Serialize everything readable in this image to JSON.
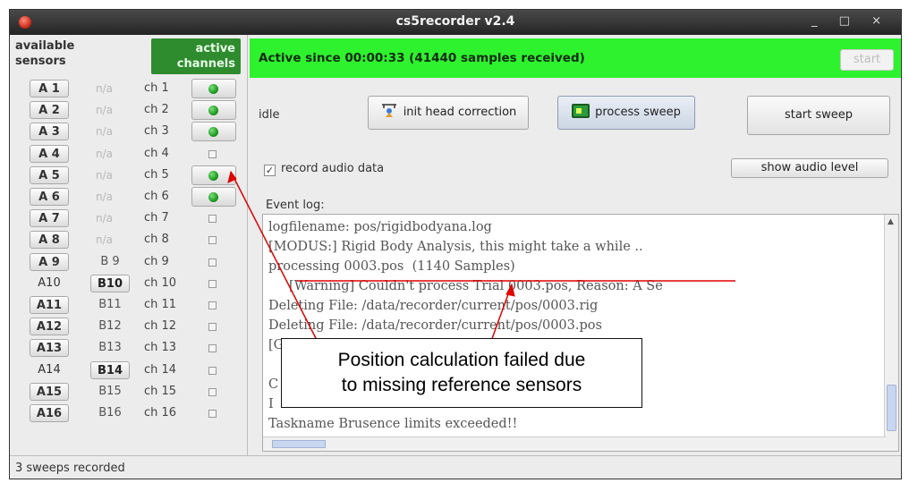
{
  "window": {
    "title": "cs5recorder v2.4",
    "controls": "_ □ ×"
  },
  "left_panel": {
    "available_header": [
      "available",
      "sensors"
    ],
    "active_header": [
      "active",
      "channels"
    ],
    "rows": [
      {
        "a": "A 1",
        "a_btn": true,
        "b": "n/a",
        "b_btn": false,
        "b_na": true,
        "ch": "ch 1",
        "active": true
      },
      {
        "a": "A 2",
        "a_btn": true,
        "b": "n/a",
        "b_btn": false,
        "b_na": true,
        "ch": "ch 2",
        "active": true
      },
      {
        "a": "A 3",
        "a_btn": true,
        "b": "n/a",
        "b_btn": false,
        "b_na": true,
        "ch": "ch 3",
        "active": true
      },
      {
        "a": "A 4",
        "a_btn": true,
        "b": "n/a",
        "b_btn": false,
        "b_na": true,
        "ch": "ch 4",
        "active": false
      },
      {
        "a": "A 5",
        "a_btn": true,
        "b": "n/a",
        "b_btn": false,
        "b_na": true,
        "ch": "ch 5",
        "active": true
      },
      {
        "a": "A 6",
        "a_btn": true,
        "b": "n/a",
        "b_btn": false,
        "b_na": true,
        "ch": "ch 6",
        "active": true
      },
      {
        "a": "A 7",
        "a_btn": true,
        "b": "n/a",
        "b_btn": false,
        "b_na": true,
        "ch": "ch 7",
        "active": false
      },
      {
        "a": "A 8",
        "a_btn": true,
        "b": "n/a",
        "b_btn": false,
        "b_na": true,
        "ch": "ch 8",
        "active": false
      },
      {
        "a": "A 9",
        "a_btn": true,
        "b": "B 9",
        "b_btn": false,
        "b_na": false,
        "ch": "ch 9",
        "active": false
      },
      {
        "a": "A10",
        "a_btn": false,
        "b": "B10",
        "b_btn": true,
        "b_na": false,
        "ch": "ch 10",
        "active": false
      },
      {
        "a": "A11",
        "a_btn": true,
        "b": "B11",
        "b_btn": false,
        "b_na": false,
        "ch": "ch 11",
        "active": false
      },
      {
        "a": "A12",
        "a_btn": true,
        "b": "B12",
        "b_btn": false,
        "b_na": false,
        "ch": "ch 12",
        "active": false
      },
      {
        "a": "A13",
        "a_btn": true,
        "b": "B13",
        "b_btn": false,
        "b_na": false,
        "ch": "ch 13",
        "active": false
      },
      {
        "a": "A14",
        "a_btn": false,
        "b": "B14",
        "b_btn": true,
        "b_na": false,
        "ch": "ch 14",
        "active": false
      },
      {
        "a": "A15",
        "a_btn": true,
        "b": "B15",
        "b_btn": false,
        "b_na": false,
        "ch": "ch 15",
        "active": false
      },
      {
        "a": "A16",
        "a_btn": true,
        "b": "B16",
        "b_btn": false,
        "b_na": false,
        "ch": "ch 16",
        "active": false
      }
    ]
  },
  "status": {
    "active_text": "Active since 00:00:33 (41440 samples received)",
    "start_label": "start",
    "idle_label": "idle",
    "bar_color": "#2ef22e"
  },
  "buttons": {
    "init_head": "init head correction",
    "process_sweep": "process sweep",
    "start_sweep": "start sweep",
    "show_audio": "show audio level"
  },
  "audio": {
    "record_label": "record audio data",
    "checked": true
  },
  "log": {
    "label": "Event log:",
    "lines": [
      "logfilename: pos/rigidbodyana.log",
      "[MODUS:] Rigid Body Analysis, this might take a while ..",
      "processing 0003.pos  (1140 Samples)",
      "     [Warning] Couldn't process Trial 0003.pos, Reason: A Se",
      "Deleting File: /data/recorder/current/pos/0003.rig",
      "Deleting File: /data/recorder/current/pos/0003.pos",
      "[Good Bye.]",
      "",
      "C",
      "I",
      "Taskname Brusence limits exceeded!!"
    ]
  },
  "footer": {
    "text": "3 sweeps recorded"
  },
  "annotation": {
    "text_line1": "Position calculation failed due",
    "text_line2": "to missing reference sensors",
    "arrow_color": "#e00000"
  },
  "icons": [
    "close-dot-icon",
    "init-head-icon",
    "process-sweep-icon",
    "checkbox-icon"
  ]
}
